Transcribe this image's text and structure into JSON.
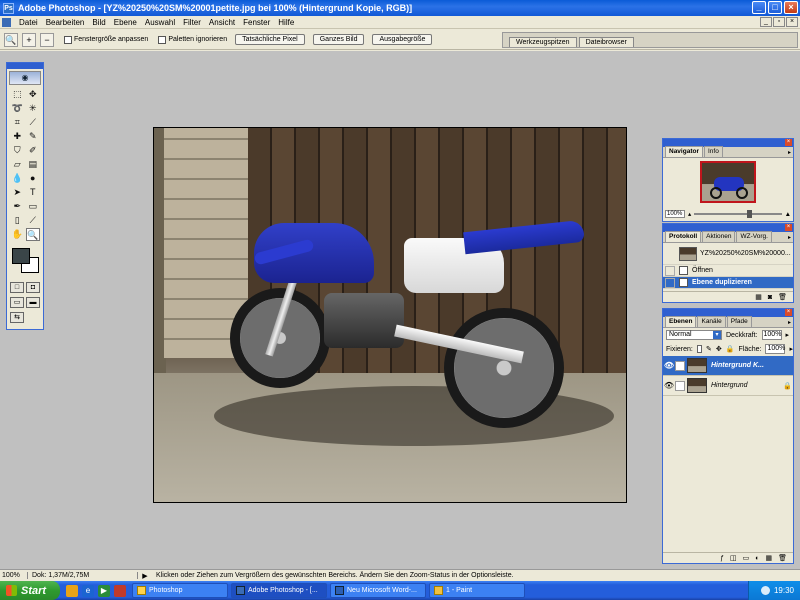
{
  "window": {
    "title": "Adobe Photoshop - [YZ%20250%20SM%20001petite.jpg bei 100% (Hintergrund Kopie, RGB)]",
    "app_icon": "Ps"
  },
  "menu": [
    "Datei",
    "Bearbeiten",
    "Bild",
    "Ebene",
    "Auswahl",
    "Filter",
    "Ansicht",
    "Fenster",
    "Hilfe"
  ],
  "options": {
    "tool_glyph": "🔍",
    "checkbox1": "Fenstergröße anpassen",
    "checkbox2": "Paletten ignorieren",
    "btn_actual": "Tatsächliche Pixel",
    "btn_fit": "Ganzes Bild",
    "btn_print": "Ausgabegröße"
  },
  "palette_well": {
    "tabs": [
      "Werkzeugspitzen",
      "Dateibrowser"
    ]
  },
  "navigator": {
    "tabs": [
      "Navigator",
      "Info"
    ],
    "zoom": "100%"
  },
  "history": {
    "tabs": [
      "Protokoll",
      "Aktionen",
      "WZ-Vorg."
    ],
    "source": "YZ%20250%20SM%20000...",
    "items": [
      {
        "label": "Öffnen"
      },
      {
        "label": "Ebene duplizieren"
      }
    ]
  },
  "layers": {
    "tabs": [
      "Ebenen",
      "Kanäle",
      "Pfade"
    ],
    "blend_mode": "Normal",
    "opacity_label": "Deckkraft:",
    "opacity": "100%",
    "lock_label": "Fixieren:",
    "fill_label": "Fläche:",
    "fill": "100%",
    "rows": [
      {
        "name": "Hintergrund K..."
      },
      {
        "name": "Hintergrund"
      }
    ]
  },
  "status": {
    "zoom": "100%",
    "doc": "Dok: 1,37M/2,75M",
    "message": "Klicken oder Ziehen zum Vergrößern des gewünschten Bereichs. Ändern Sie den Zoom-Status in der Optionsleiste."
  },
  "taskbar": {
    "start": "Start",
    "tasks": [
      "Photoshop",
      "Adobe Photoshop - [...",
      "Neu Microsoft Word-...",
      "1 - Paint"
    ],
    "time": "19:30"
  }
}
